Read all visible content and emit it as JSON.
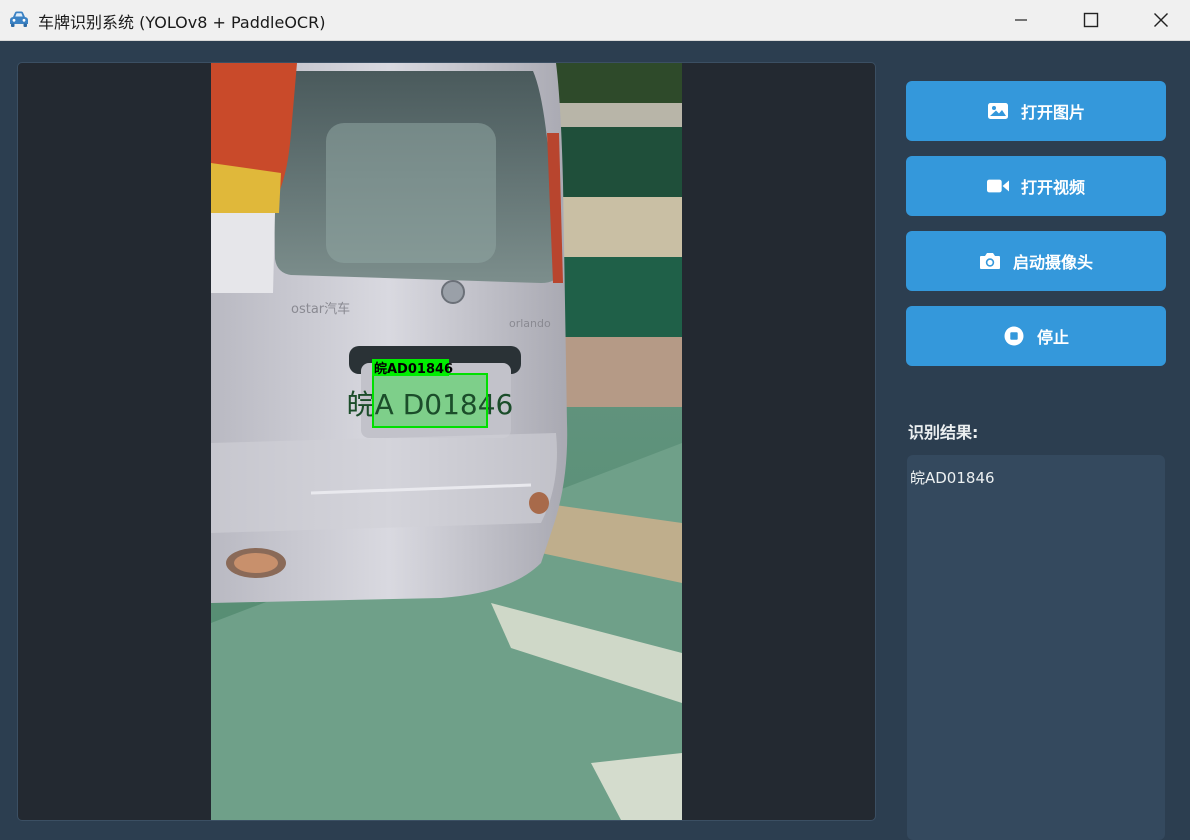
{
  "window": {
    "title": "车牌识别系统 (YOLOv8 + PaddleOCR)"
  },
  "buttons": {
    "open_image": "打开图片",
    "open_video": "打开视频",
    "start_camera": "启动摄像头",
    "stop": "停止"
  },
  "results": {
    "label": "识别结果:",
    "text": "皖AD01846"
  },
  "detection": {
    "tag": "皖AD01846",
    "plate": "皖A D01846",
    "box_color": "#00e000"
  },
  "colors": {
    "accent": "#3498db",
    "background": "#2c3e50",
    "panel": "#34495e",
    "display": "#232931"
  },
  "icons": {
    "app": "car-icon",
    "open_image": "image-icon",
    "open_video": "video-camera-icon",
    "start_camera": "camera-icon",
    "stop": "stop-icon"
  }
}
